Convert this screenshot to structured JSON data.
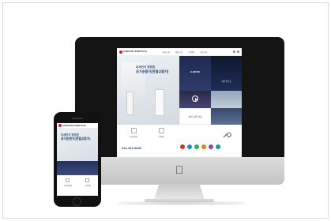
{
  "site": {
    "brand": "SAMSUNG ENERTECH",
    "nav": [
      "회사소개",
      "제품소개",
      "고객센터",
      "커뮤니티"
    ],
    "hero": {
      "line1": "미세먼지 청정함",
      "line2": "공기순환기(전열교환기)"
    },
    "tiles": {
      "ebook": "E-BOOK",
      "tech": "기술 연구소",
      "service": "서비스센터 안내"
    },
    "info": {
      "left_label": "온라인견적",
      "right_label": "고객상담",
      "phone": "041-362-9838"
    },
    "cert_colors": [
      "#c0392b",
      "#2e86c1",
      "#27ae60",
      "#d68910",
      "#8e44ad",
      "#16a085"
    ]
  },
  "mobile": {
    "brand": "SAMSUNG ENERTECH",
    "hero": {
      "line1": "미세먼지 청정함",
      "line2": "공기순환기(전열교환기)"
    },
    "left_label": "온라인견적",
    "right_label": "고객상담"
  },
  "icons": [
    "apple-logo-icon",
    "play-icon",
    "wrench-icon",
    "menu-icon",
    "search-icon"
  ]
}
